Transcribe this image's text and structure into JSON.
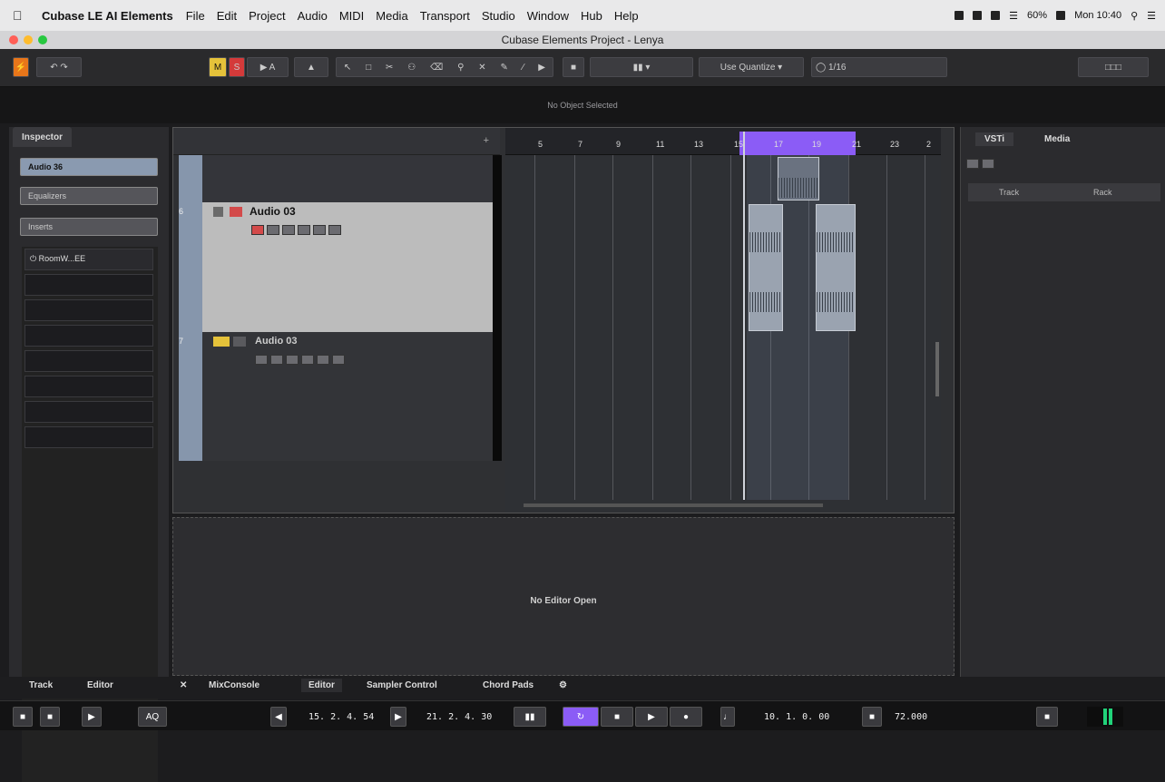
{
  "menubar": {
    "app_name": "Cubase LE AI Elements",
    "items": [
      "File",
      "Edit",
      "Project",
      "Audio",
      "MIDI",
      "Media",
      "Transport",
      "Studio",
      "Window",
      "Hub",
      "Help"
    ],
    "battery": "60%",
    "clock": "Mon 10:40"
  },
  "window": {
    "title": "Cubase Elements Project - Lenya"
  },
  "toolbar": {
    "snap_mode": "Use Quantize",
    "quantize_value": "1/16"
  },
  "info_line": {
    "text": "No Object Selected"
  },
  "inspector": {
    "tab": "Inspector",
    "track_name": "Audio 36",
    "section_equalizers": "Equalizers",
    "section_inserts": "Inserts",
    "insert_slot_1": "RoomW...EE"
  },
  "tracks": [
    {
      "number": "6",
      "name": "Audio 03"
    },
    {
      "number": "7",
      "name": "Audio 03"
    }
  ],
  "ruler": {
    "bars": [
      "5",
      "7",
      "9",
      "11",
      "13",
      "15",
      "17",
      "19",
      "21",
      "23",
      "2"
    ]
  },
  "editor": {
    "empty_text": "No Editor Open"
  },
  "right_zone": {
    "tabs": [
      "VSTi",
      "Media"
    ],
    "col_track": "Track",
    "col_rack": "Rack"
  },
  "bottom_tabs": {
    "left": [
      "Track",
      "Editor"
    ],
    "lower_zone": [
      "MixConsole",
      "Editor",
      "Sampler Control",
      "Chord Pads"
    ]
  },
  "transport": {
    "left_locator": "15. 2. 4. 54",
    "right_locator": "21. 2. 4. 30",
    "position": "10. 1. 0. 00",
    "tempo": "72.000"
  }
}
